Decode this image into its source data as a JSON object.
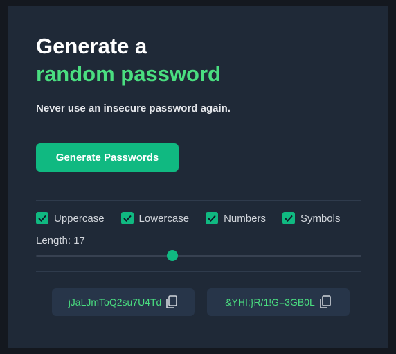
{
  "hero": {
    "title_line1": "Generate a",
    "title_line2": "random password",
    "subtitle": "Never use an insecure password again."
  },
  "generate_button": "Generate Passwords",
  "options": [
    {
      "label": "Uppercase",
      "checked": true
    },
    {
      "label": "Lowercase",
      "checked": true
    },
    {
      "label": "Numbers",
      "checked": true
    },
    {
      "label": "Symbols",
      "checked": true
    }
  ],
  "length": {
    "label": "Length: 17",
    "value": 17,
    "slider_fraction": 0.42
  },
  "passwords": [
    {
      "value": "jJaLJmToQ2su7U4Td",
      "icon": "copy-icon"
    },
    {
      "value": "&YHI;}R/1!G=3GB0L",
      "icon": "copy-icon"
    }
  ],
  "colors": {
    "background": "#1f2937",
    "accent": "#10b981",
    "accent_text": "#4ade80"
  }
}
